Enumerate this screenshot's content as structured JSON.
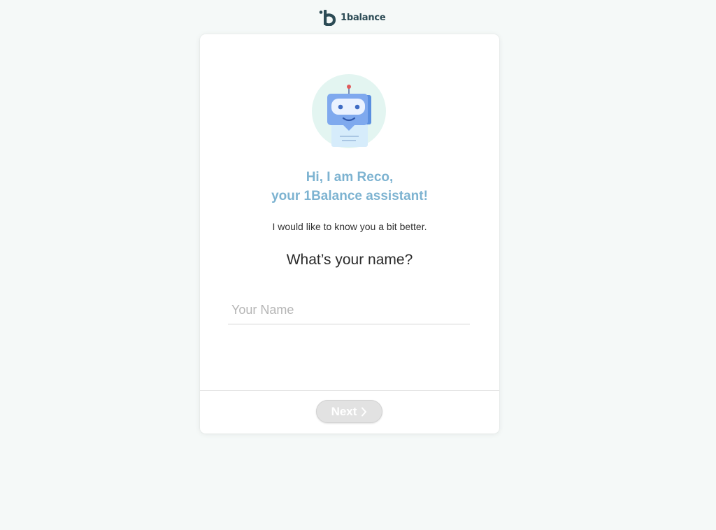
{
  "brand": {
    "name": "1balance",
    "logo_icon": "1balance-logo-icon"
  },
  "assistant": {
    "avatar_icon": "robot-icon",
    "greeting_line1": "Hi, I am Reco,",
    "greeting_line2": "your 1Balance assistant!",
    "subtitle": "I would like to know you a bit better.",
    "question": "What’s your name?"
  },
  "form": {
    "name_placeholder": "Your Name",
    "name_value": ""
  },
  "actions": {
    "next_label": "Next",
    "next_icon": "chevron-right-icon",
    "next_enabled": false
  },
  "colors": {
    "background": "#f5f9f8",
    "accent": "#7db3d1",
    "brand_dark": "#2c4b55",
    "button_disabled": "#e2e2e2"
  }
}
